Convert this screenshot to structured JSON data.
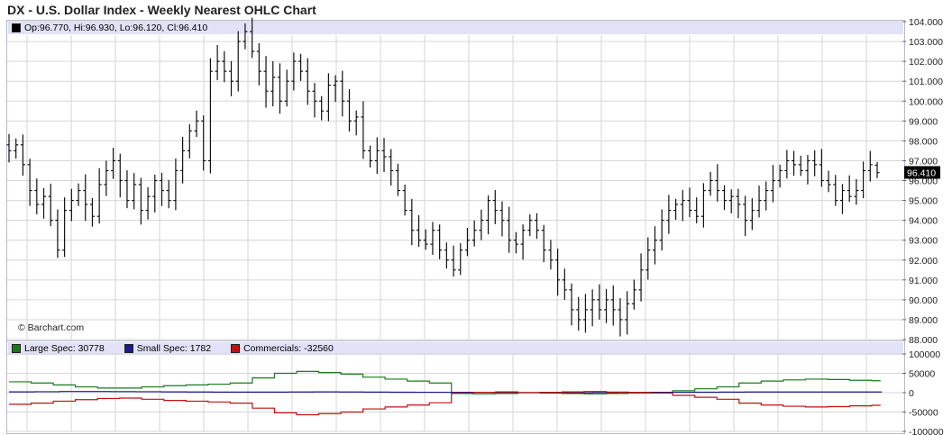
{
  "title": "DX - U.S. Dollar Index - Weekly Nearest OHLC Chart",
  "credit": "© Barchart.com",
  "ohlc_legend": {
    "open": "Op:96.770",
    "high": "Hi:96.930",
    "low": "Lo:96.120",
    "close": "Cl:96.410",
    "color": "#000000"
  },
  "last_price_label": "96.410",
  "cot_legend": [
    {
      "label": "Large Spec: 30778",
      "color": "#1a7a1a"
    },
    {
      "label": "Small Spec: 1782",
      "color": "#1a1a8c"
    },
    {
      "label": "Commercials: -32560",
      "color": "#c01010"
    }
  ],
  "chart_data": [
    {
      "type": "ohlc",
      "title": "DX - U.S. Dollar Index - Weekly Nearest OHLC Chart",
      "ylim": [
        88,
        104
      ],
      "y_ticks": [
        "104.000",
        "103.000",
        "102.000",
        "101.000",
        "100.000",
        "99.000",
        "98.000",
        "97.000",
        "96.000",
        "95.000",
        "94.000",
        "93.000",
        "92.000",
        "91.000",
        "90.000",
        "89.000",
        "88.000"
      ],
      "grid": true,
      "last": {
        "open": 96.77,
        "high": 96.93,
        "low": 96.12,
        "close": 96.41
      },
      "approx_close_series": [
        97.5,
        97.8,
        96.8,
        95.5,
        94.8,
        95.2,
        94.0,
        92.5,
        94.5,
        95.0,
        95.5,
        94.8,
        94.2,
        95.8,
        96.5,
        97.0,
        96.0,
        95.0,
        95.8,
        94.5,
        95.2,
        96.0,
        95.5,
        95.0,
        96.5,
        97.5,
        98.5,
        99.0,
        97.0,
        101.5,
        102.0,
        101.5,
        101.0,
        103.0,
        103.5,
        102.5,
        101.5,
        100.5,
        101.2,
        100.0,
        101.0,
        102.0,
        101.5,
        100.5,
        100.0,
        99.5,
        100.8,
        101.0,
        100.0,
        99.0,
        99.2,
        97.5,
        97.0,
        97.5,
        97.2,
        96.5,
        95.5,
        94.5,
        93.5,
        93.0,
        92.8,
        93.5,
        92.5,
        92.0,
        91.5,
        92.5,
        93.0,
        93.5,
        94.0,
        95.0,
        94.5,
        94.0,
        93.0,
        92.8,
        93.5,
        94.0,
        93.5,
        92.5,
        92.0,
        91.0,
        90.5,
        89.5,
        89.0,
        89.5,
        90.0,
        89.5,
        90.0,
        89.5,
        89.0,
        89.8,
        90.5,
        91.5,
        92.5,
        93.0,
        94.0,
        94.5,
        94.8,
        95.0,
        94.5,
        94.2,
        95.5,
        96.0,
        95.5,
        95.0,
        95.2,
        94.8,
        94.0,
        94.5,
        95.0,
        95.5,
        96.0,
        96.5,
        97.0,
        96.8,
        96.5,
        97.0,
        96.8,
        96.0,
        95.8,
        95.0,
        95.5,
        95.2,
        95.5,
        96.5,
        96.8,
        96.4
      ]
    },
    {
      "type": "line",
      "ylim": [
        -100000,
        100000
      ],
      "y_ticks": [
        "100000",
        "50000",
        "0",
        "-50000",
        "-100000"
      ],
      "grid": true,
      "series": [
        {
          "name": "Large Spec: 30778",
          "color": "#1a7a1a",
          "approx_values": [
            28000,
            25000,
            20000,
            15000,
            12000,
            12000,
            15000,
            18000,
            20000,
            22000,
            25000,
            38000,
            50000,
            55000,
            52000,
            48000,
            40000,
            35000,
            30000,
            25000,
            -2000,
            -3000,
            -2000,
            0,
            -1000,
            -2000,
            -3000,
            -2000,
            -1000,
            0,
            5000,
            10000,
            15000,
            25000,
            30000,
            33000,
            35000,
            34000,
            32000,
            30778
          ]
        },
        {
          "name": "Small Spec: 1782",
          "color": "#1a1a8c",
          "approx_values": [
            2000,
            2500,
            3000,
            3000,
            2800,
            2500,
            2000,
            1800,
            1500,
            1500,
            1500,
            1800,
            2000,
            1800,
            1500,
            1200,
            1000,
            1000,
            800,
            500,
            200,
            0,
            -500,
            0,
            500,
            800,
            1000,
            1200,
            1500,
            1800,
            1800,
            1800,
            1700,
            1800,
            1782
          ]
        },
        {
          "name": "Commercials: -32560",
          "color": "#c01010",
          "approx_values": [
            -30000,
            -27000,
            -22000,
            -18000,
            -15000,
            -14000,
            -17000,
            -20000,
            -22000,
            -24000,
            -27000,
            -40000,
            -52000,
            -57000,
            -54000,
            -50000,
            -42000,
            -37000,
            -32000,
            -26000,
            -1000,
            1000,
            2000,
            0,
            1000,
            2000,
            3000,
            1500,
            500,
            -1000,
            -7000,
            -12000,
            -17000,
            -27000,
            -32000,
            -35000,
            -37000,
            -36000,
            -34000,
            -32560
          ]
        }
      ]
    }
  ]
}
